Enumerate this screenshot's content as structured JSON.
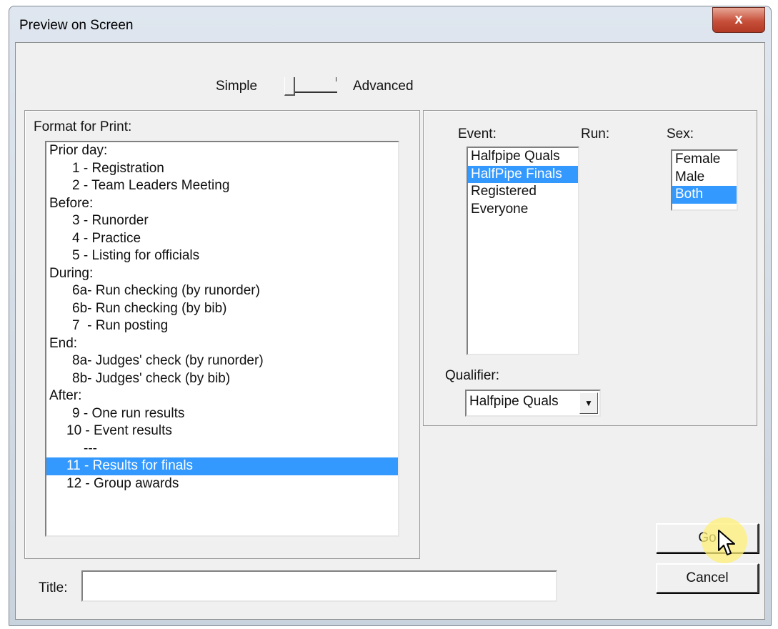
{
  "window": {
    "title": "Preview on Screen",
    "close_glyph": "x"
  },
  "mode": {
    "simple_label": "Simple",
    "advanced_label": "Advanced"
  },
  "format": {
    "label": "Format for Print:",
    "items": [
      "Prior day:",
      "1 - Registration",
      "2 - Team Leaders Meeting",
      "Before:",
      "3 - Runorder",
      "4 - Practice",
      "5 - Listing for officials",
      "During:",
      "6a- Run checking (by runorder)",
      "6b- Run checking (by bib)",
      "7  - Run posting",
      "End:",
      "8a- Judges' check (by runorder)",
      "8b- Judges' check (by bib)",
      "After:",
      "9 - One run results",
      "10 - Event results",
      "---",
      "11 - Results for finals",
      "12 - Group awards"
    ],
    "selected_item": "11 - Results for finals"
  },
  "event": {
    "label": "Event:",
    "items": [
      "Halfpipe Quals",
      "HalfPipe Finals",
      "Registered",
      "Everyone"
    ],
    "selected_item": "HalfPipe Finals"
  },
  "run": {
    "label": "Run:"
  },
  "sex": {
    "label": "Sex:",
    "items": [
      "Female",
      "Male",
      "Both"
    ],
    "selected_item": "Both"
  },
  "qualifier": {
    "label": "Qualifier:",
    "value": "Halfpipe Quals"
  },
  "title_field": {
    "label": "Title:",
    "value": ""
  },
  "buttons": {
    "go_label": "Go",
    "cancel_label": "Cancel"
  },
  "colors": {
    "selection": "#3399ff",
    "close_button": "#c7503a"
  }
}
